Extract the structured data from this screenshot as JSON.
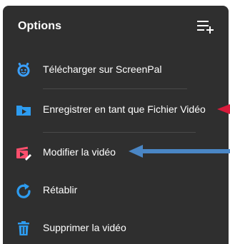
{
  "menu": {
    "title": "Options",
    "items": [
      {
        "label": "Télécharger sur ScreenPal",
        "icon": "screenpal-logo-icon",
        "color": "#3aa0ff"
      },
      {
        "label": "Enregistrer en tant que Fichier Vidéo",
        "icon": "video-folder-icon",
        "color": "#2d9cf0"
      },
      {
        "label": "Modifier la vidéo",
        "icon": "video-edit-icon",
        "color": "#ff4f6d"
      },
      {
        "label": "Rétablir",
        "icon": "redo-icon",
        "color": "#2d9cf0"
      },
      {
        "label": "Supprimer la vidéo",
        "icon": "trash-icon",
        "color": "#2d9cf0"
      }
    ]
  },
  "colors": {
    "panel_background": "#2f2f2f",
    "text": "#ffffff",
    "accent_blue": "#2d9cf0",
    "accent_red": "#d81b3b",
    "annotation_arrow": "#4a86c5"
  }
}
